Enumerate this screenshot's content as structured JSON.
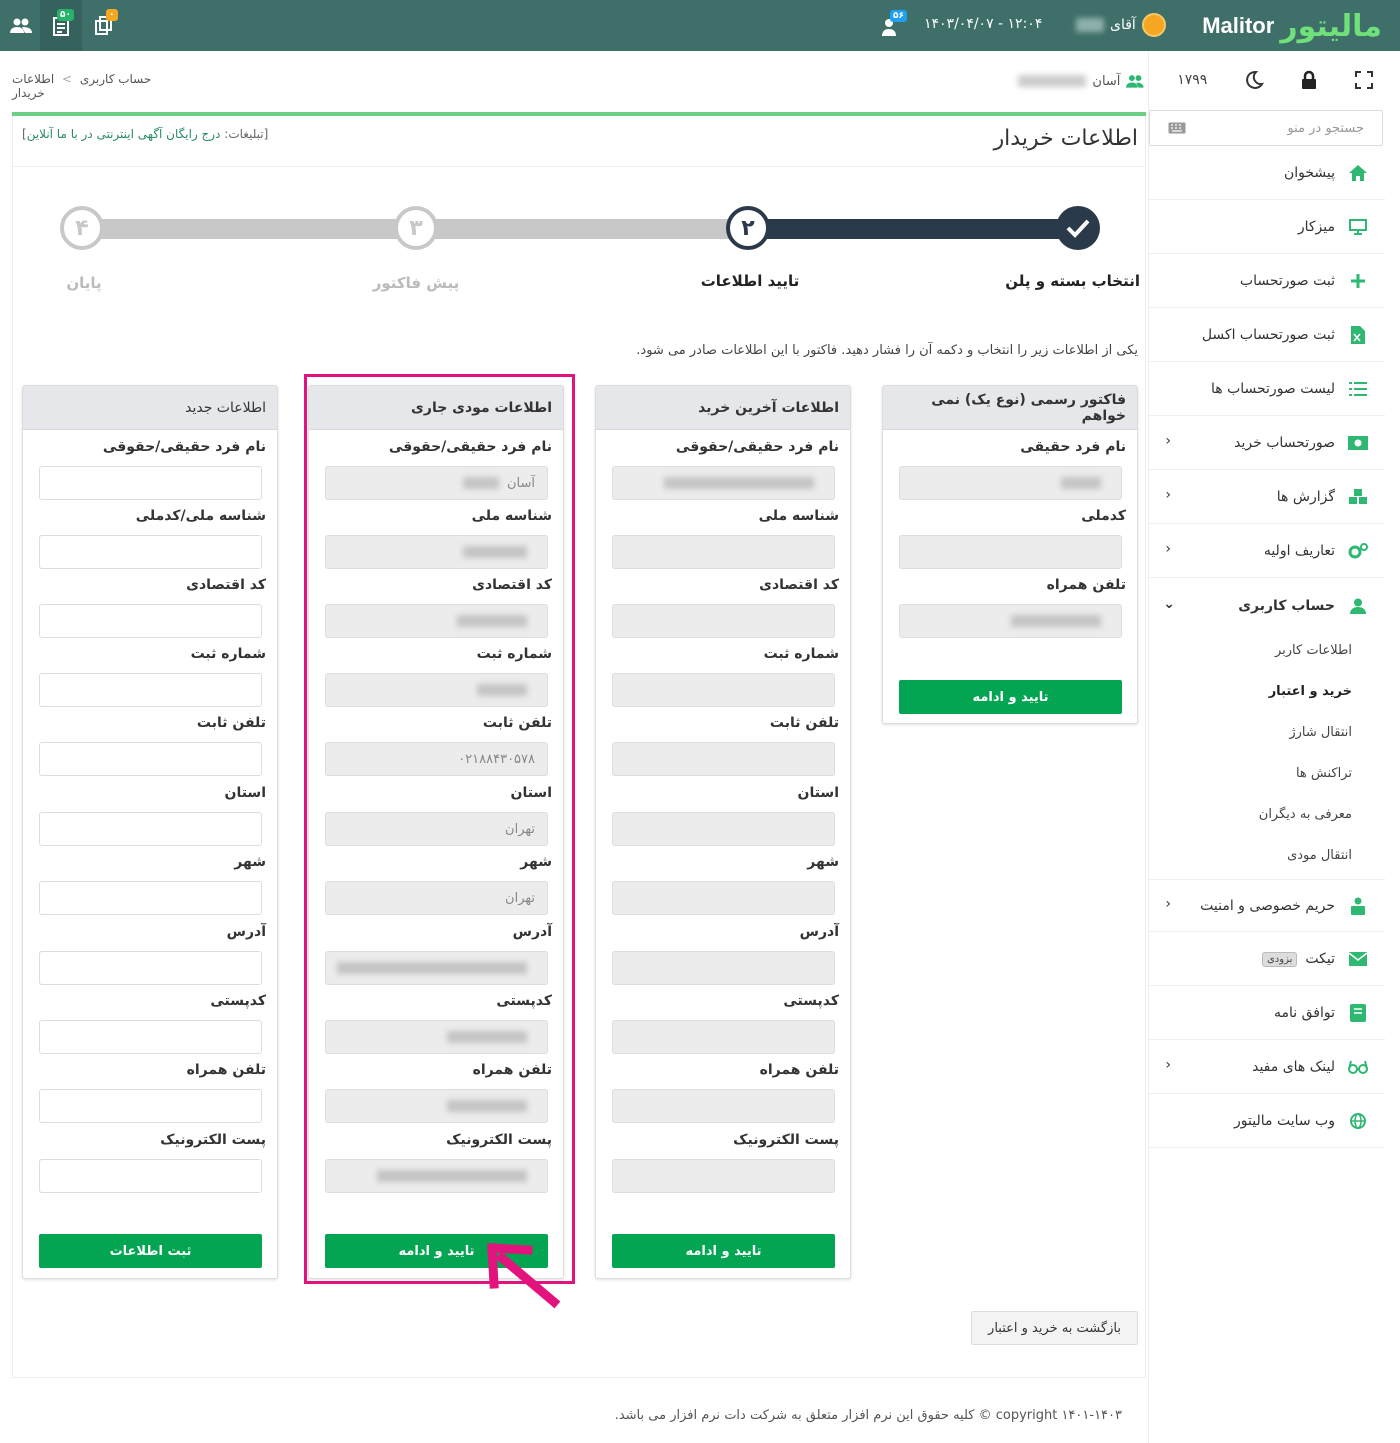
{
  "topbar": {
    "logo_en": "Malitor",
    "logo_fa": "مالیتور",
    "user_greeting": "آقای",
    "datetime": "۱۴۰۳/۰۴/۰۷ - ۱۲:۰۴",
    "bell_badge": "۵۶",
    "invoice_badge": "۵۰",
    "copy_badge": "۰"
  },
  "sidebar": {
    "credit": "۱۷۹۹",
    "search_placeholder": "جستجو در منو",
    "items": [
      {
        "label": "پیشخوان",
        "icon": "home-icon"
      },
      {
        "label": "میزکار",
        "icon": "monitor-icon"
      },
      {
        "label": "ثبت صورتحساب",
        "icon": "plus-icon"
      },
      {
        "label": "ثبت صورتحساب اکسل",
        "icon": "excel-icon"
      },
      {
        "label": "لیست صورتحساب ها",
        "icon": "list-icon"
      },
      {
        "label": "صورتحساب خرید",
        "icon": "money-icon"
      },
      {
        "label": "گزارش ها",
        "icon": "cubes-icon"
      },
      {
        "label": "تعاریف اولیه",
        "icon": "gears-icon"
      },
      {
        "label": "حساب کاربری",
        "icon": "user-icon"
      },
      {
        "label": "حریم خصوصی و امنیت",
        "icon": "lock-user-icon"
      },
      {
        "label": "تیکت",
        "icon": "envelope-icon",
        "tag": "بزودی"
      },
      {
        "label": "توافق نامه",
        "icon": "book-icon"
      },
      {
        "label": "لینک های مفید",
        "icon": "glasses-icon"
      },
      {
        "label": "وب سایت مالیتور",
        "icon": "globe-icon"
      }
    ],
    "subitems": [
      "اطلاعات کاربر",
      "خرید و اعتبار",
      "انتقال شارژ",
      "تراکنش ها",
      "معرفی به دیگران",
      "انتقال مودی"
    ]
  },
  "breadcrumb": {
    "parent": "حساب کاربری",
    "sep": ">",
    "current": "اطلاعات خریدار"
  },
  "company": {
    "label": "آسان"
  },
  "main": {
    "title": "اطلاعات خریدار",
    "ads_prefix": "[تبلیغات:",
    "ads_text": "درج رایگان آگهی اینترنتی در با ما آنلاین",
    "ads_suffix": "]",
    "instruction": "یکی از اطلاعات زیر را انتخاب و دکمه آن را فشار دهید. فاکتور با این اطلاعات صادر می شود.",
    "back_button": "بازگشت به خرید و اعتبار"
  },
  "steps": [
    {
      "label": "انتخاب بسته و پلن",
      "number": "✓",
      "state": "done"
    },
    {
      "label": "تایید اطلاعات",
      "number": "۲",
      "state": "current"
    },
    {
      "label": "پیش فاکتور",
      "number": "۳",
      "state": "todo"
    },
    {
      "label": "پایان",
      "number": "۴",
      "state": "todo"
    }
  ],
  "cards": {
    "no_invoice": {
      "title": "فاکتور رسمی (نوع یک) نمی خواهم",
      "labels": [
        "نام فرد حقیقی",
        "کدملی",
        "تلفن همراه"
      ],
      "button": "تایید و ادامه"
    },
    "last_purchase": {
      "title": "اطلاعات آخرین خرید",
      "labels": [
        "نام فرد حقیقی/حقوقی",
        "شناسه ملی",
        "کد اقتصادی",
        "شماره ثبت",
        "تلفن ثابت",
        "استان",
        "شهر",
        "آدرس",
        "کدپستی",
        "تلفن همراه",
        "پست الکترونیک"
      ],
      "button": "تایید و ادامه"
    },
    "current_taxpayer": {
      "title": "اطلاعات مودی جاری",
      "labels": [
        "نام فرد حقیقی/حقوقی",
        "شناسه ملی",
        "کد اقتصادی",
        "شماره ثبت",
        "تلفن ثابت",
        "استان",
        "شهر",
        "آدرس",
        "کدپستی",
        "تلفن همراه",
        "پست الکترونیک"
      ],
      "values": {
        "name": "آسان",
        "phone": "۰۲۱۸۸۴۳۰۵۷۸",
        "province": "تهران",
        "city": "تهران"
      },
      "button": "تایید و ادامه"
    },
    "new_info": {
      "title": "اطلاعات جدید",
      "labels": [
        "نام فرد حقیقی/حقوقی",
        "شناسه ملی/کدملی",
        "کد اقتصادی",
        "شماره ثبت",
        "تلفن ثابت",
        "استان",
        "شهر",
        "آدرس",
        "کدپستی",
        "تلفن همراه",
        "پست الکترونیک"
      ],
      "button": "ثبت اطلاعات"
    }
  },
  "footer": {
    "text": "copyright ۱۴۰۱-۱۴۰۳ © کلیه حقوق این نرم افزار متعلق به شرکت دات نرم افزار می باشد."
  },
  "colors": {
    "header": "#3e6f68",
    "accent_green": "#03a552",
    "highlight": "#e3137e",
    "step_dark": "#2b3a4a"
  }
}
